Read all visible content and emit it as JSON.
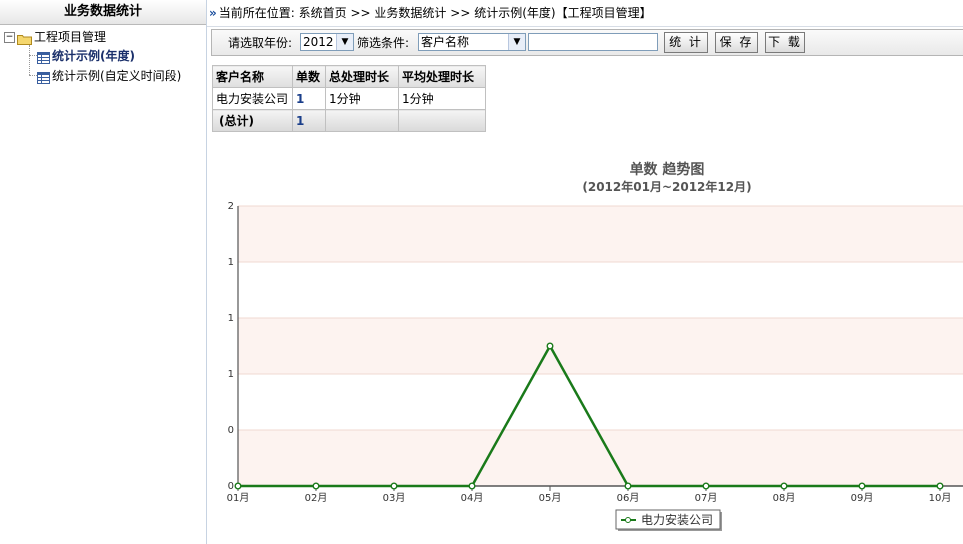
{
  "sidebar": {
    "title": "业务数据统计",
    "tree": {
      "root_label": "工程项目管理",
      "items": [
        {
          "label": "统计示例(年度)",
          "active": true
        },
        {
          "label": "统计示例(自定义时间段)",
          "active": false
        }
      ]
    }
  },
  "breadcrumb": {
    "prefix": "当前所在位置:",
    "home": "系统首页",
    "sep": ">>",
    "level1": "业务数据统计",
    "level2": "统计示例(年度)【工程项目管理】"
  },
  "toolbar": {
    "year_label": "请选取年份:",
    "year_value": "2012",
    "filter_label": "筛选条件:",
    "filter_value": "客户名称",
    "filter_text": "",
    "stat_button": "统 计",
    "save_button": "保 存",
    "download_button": "下 载"
  },
  "table": {
    "headers": [
      "客户名称",
      "单数",
      "总处理时长",
      "平均处理时长"
    ],
    "rows": [
      [
        "电力安装公司",
        "1",
        "1分钟",
        "1分钟"
      ]
    ],
    "total": [
      "(总计)",
      "1",
      "",
      ""
    ]
  },
  "chart_data": {
    "type": "line",
    "title": "单数  趋势图",
    "subtitle": "(2012年01月~2012年12月)",
    "categories": [
      "01月",
      "02月",
      "03月",
      "04月",
      "05月",
      "06月",
      "07月",
      "08月",
      "09月",
      "10月"
    ],
    "series": [
      {
        "name": "电力安装公司",
        "values": [
          0,
          0,
          0,
          0,
          1,
          0,
          0,
          0,
          0,
          0
        ]
      }
    ],
    "yticks": [
      "0",
      "0",
      "1",
      "1",
      "1",
      "2"
    ],
    "ylim": [
      0,
      2
    ],
    "line_color": "#1a7a1a",
    "band_color": "#fdf3f0",
    "grid": true,
    "legend_position": "bottom"
  }
}
